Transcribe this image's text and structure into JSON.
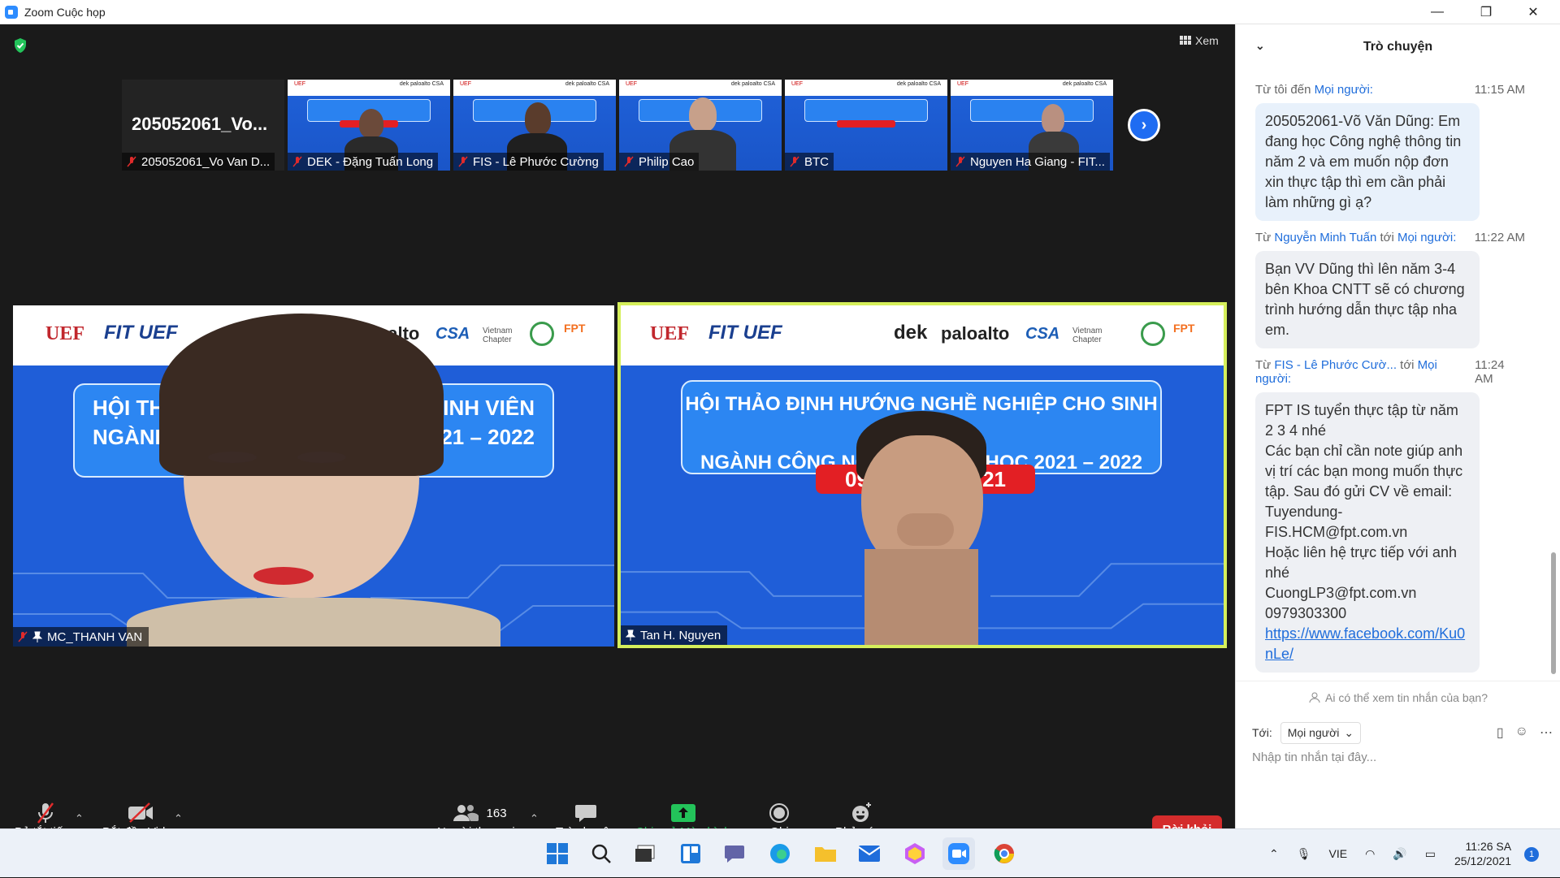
{
  "window": {
    "title": "Zoom Cuộc họp",
    "min": "—",
    "max": "❐",
    "close": "✕"
  },
  "view_button": {
    "icon": "grid-icon",
    "label": "Xem"
  },
  "thumbnails": [
    {
      "name": "205052061_Vo Van D...",
      "big_label": "205052061_Vo..."
    },
    {
      "name": "DEK - Đặng Tuấn Long"
    },
    {
      "name": "FIS - Lê Phước Cường"
    },
    {
      "name": "Philip Cao"
    },
    {
      "name": "BTC"
    },
    {
      "name": "Nguyen Ha Giang - FIT..."
    }
  ],
  "main_videos": [
    {
      "name": "MC_THANH VAN",
      "slide_line1": "HỘI THẢO",
      "slide_line1b": "CHO SINH VIÊN",
      "slide_line2": "NGÀNH CÔ",
      "slide_line2b": "C 2021 – 2022"
    },
    {
      "name": "Tan H. Nguyen",
      "slide_line1": "HỘI THẢO ĐỊNH HƯỚNG NGHỀ NGHIỆP CHO SINH VIÊN",
      "slide_line2": "NGÀNH CÔNG NGHỆ T",
      "slide_line2b": "NĂM HỌC 2021 – 2022",
      "date": "09",
      "date_b": "21"
    }
  ],
  "slide_logos": {
    "uef": "UEF",
    "fit": "FIT UEF",
    "dek": "dek",
    "paloalto": "paloalto",
    "csa": "CSA",
    "vn": "Vietnam Chapter"
  },
  "toolbar": {
    "mute": "Bỏ tắt tiếng",
    "video": "Bắt đầu Video",
    "participants": "Người tham gia",
    "participants_count": "163",
    "chat": "Trò chuyện",
    "share": "Chia sẻ Màn hình",
    "record": "Ghi",
    "reactions": "Phản ứng",
    "leave": "Rời khỏi"
  },
  "chat": {
    "title": "Trò chuyện",
    "messages": [
      {
        "prefix": "Từ tôi đến ",
        "to": "Mọi người:",
        "time": "11:15 AM",
        "text": "205052061-Võ Văn Dũng: Em đang học Công nghệ thông tin năm 2 và em muốn nộp đơn xin thực tập thì em cần phải làm những gì ạ?"
      },
      {
        "prefix": "Từ ",
        "from": "Nguyễn Minh Tuấn",
        "mid": " tới ",
        "to": "Mọi người:",
        "time": "11:22 AM",
        "text": "Bạn VV Dũng thì lên năm 3-4 bên Khoa CNTT sẽ có chương trình hướng dẫn thực tập nha em."
      },
      {
        "prefix": "Từ ",
        "from": "FIS - Lê Phước Cườ...",
        "mid": " tới ",
        "to": "Mọi người:",
        "time": "11:24 AM",
        "lines": [
          "FPT IS tuyển thực tập từ năm 2 3 4 nhé",
          "Các bạn chỉ cần note giúp anh vị trí các bạn mong muốn thực tập. Sau đó gửi CV về email: Tuyendung-FIS.HCM@fpt.com.vn",
          "Hoặc liên hệ trực tiếp với anh nhé",
          "CuongLP3@fpt.com.vn",
          "0979303300"
        ],
        "link": "https://www.facebook.com/Ku0nLe/"
      }
    ],
    "who_sees": "Ai có thể xem tin nhắn của bạn?",
    "to_label": "Tới:",
    "to_value": "Mọi người",
    "placeholder": "Nhập tin nhắn tại đây..."
  },
  "taskbar": {
    "lang": "VIE",
    "time": "11:26 SA",
    "date": "25/12/2021",
    "notif": "1"
  },
  "colors": {
    "accent": "#2d8cff",
    "leave": "#d42c2c",
    "share": "#23c35a",
    "active": "#d5ef5b",
    "link": "#1f6ddb"
  }
}
